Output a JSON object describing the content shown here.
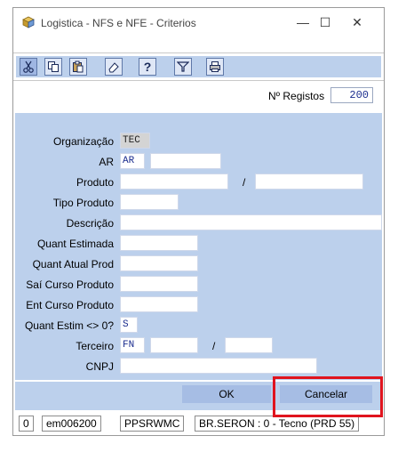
{
  "window": {
    "title": "Logistica - NFS e NFE - Criterios",
    "minimize_glyph": "—",
    "maximize_glyph": "☐",
    "close_glyph": "✕"
  },
  "toolbar": {
    "buttons": [
      {
        "name": "cut-icon",
        "glyph": "✂"
      },
      {
        "name": "copy-icon",
        "glyph": "⎘"
      },
      {
        "name": "paste-icon",
        "glyph": "📋"
      },
      {
        "name": "eraser-icon",
        "glyph": "⌫"
      },
      {
        "name": "help-icon",
        "glyph": "?"
      },
      {
        "name": "filter-icon",
        "glyph": "⊽"
      },
      {
        "name": "print-icon",
        "glyph": "⎙"
      }
    ]
  },
  "registos": {
    "label": "Nº Registos",
    "value": "200"
  },
  "form": {
    "organizacao": {
      "label": "Organização",
      "value": "TEC"
    },
    "ar": {
      "label": "AR",
      "value": "AR",
      "value2": ""
    },
    "produto": {
      "label": "Produto",
      "value": "",
      "separator": "/",
      "value2": ""
    },
    "tipo_produto": {
      "label": "Tipo Produto",
      "value": ""
    },
    "descricao": {
      "label": "Descrição",
      "value": ""
    },
    "quant_estimada": {
      "label": "Quant Estimada",
      "value": ""
    },
    "quant_atual_prod": {
      "label": "Quant Atual Prod",
      "value": ""
    },
    "sai_curso_produto": {
      "label": "Saí Curso Produto",
      "value": ""
    },
    "ent_curso_produto": {
      "label": "Ent Curso Produto",
      "value": ""
    },
    "quant_estim_ne0": {
      "label": "Quant Estim <> 0?",
      "value": "S"
    },
    "terceiro": {
      "label": "Terceiro",
      "value": "FN",
      "value2": "",
      "separator": "/",
      "value3": ""
    },
    "cnpj": {
      "label": "CNPJ",
      "value": ""
    }
  },
  "buttons": {
    "ok": "OK",
    "cancelar": "Cancelar"
  },
  "status": {
    "cell1": "0",
    "cell2": "em006200",
    "cell3": "PPSRWMC",
    "cell4": "BR.SERON : 0 - Tecno (PRD 55)"
  },
  "colors": {
    "panel": "#bcd0ec",
    "field_text": "#1c2e8f",
    "highlight": "#e0141e"
  }
}
